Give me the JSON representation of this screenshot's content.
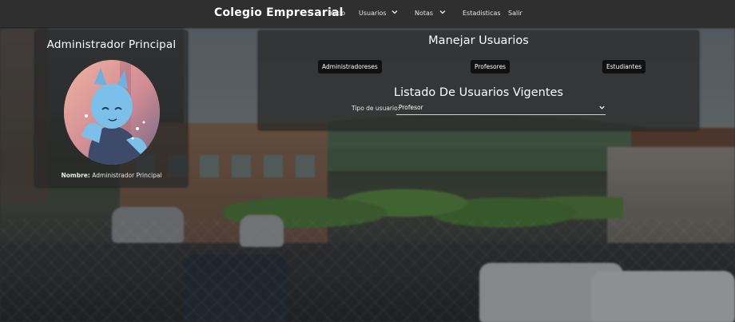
{
  "navbar": {
    "brand": "Colegio Empresarial",
    "items": [
      {
        "label": "Inicio",
        "dropdown": false
      },
      {
        "label": "Usuarios",
        "dropdown": true
      },
      {
        "label": "Notas",
        "dropdown": true
      },
      {
        "label": "Estadisticas",
        "dropdown": false
      },
      {
        "label": "Salir",
        "dropdown": false
      }
    ]
  },
  "profile": {
    "title": "Administrador Principal",
    "name_label": "Nombre:",
    "name_value": "Administrador Principal",
    "avatar_icon": "avatar-illustration"
  },
  "manage": {
    "title": "Manejar Usuarios",
    "buttons": [
      "Administradoreses",
      "Profesores",
      "Estudiantes"
    ]
  },
  "listing": {
    "title": "Listado De Usuarios Vigentes",
    "filter_label": "Tipo de usuario:",
    "filter_value": "Profesor"
  },
  "colors": {
    "navbar": "#2f2f2f",
    "button": "#111111",
    "panel": "#282828"
  }
}
